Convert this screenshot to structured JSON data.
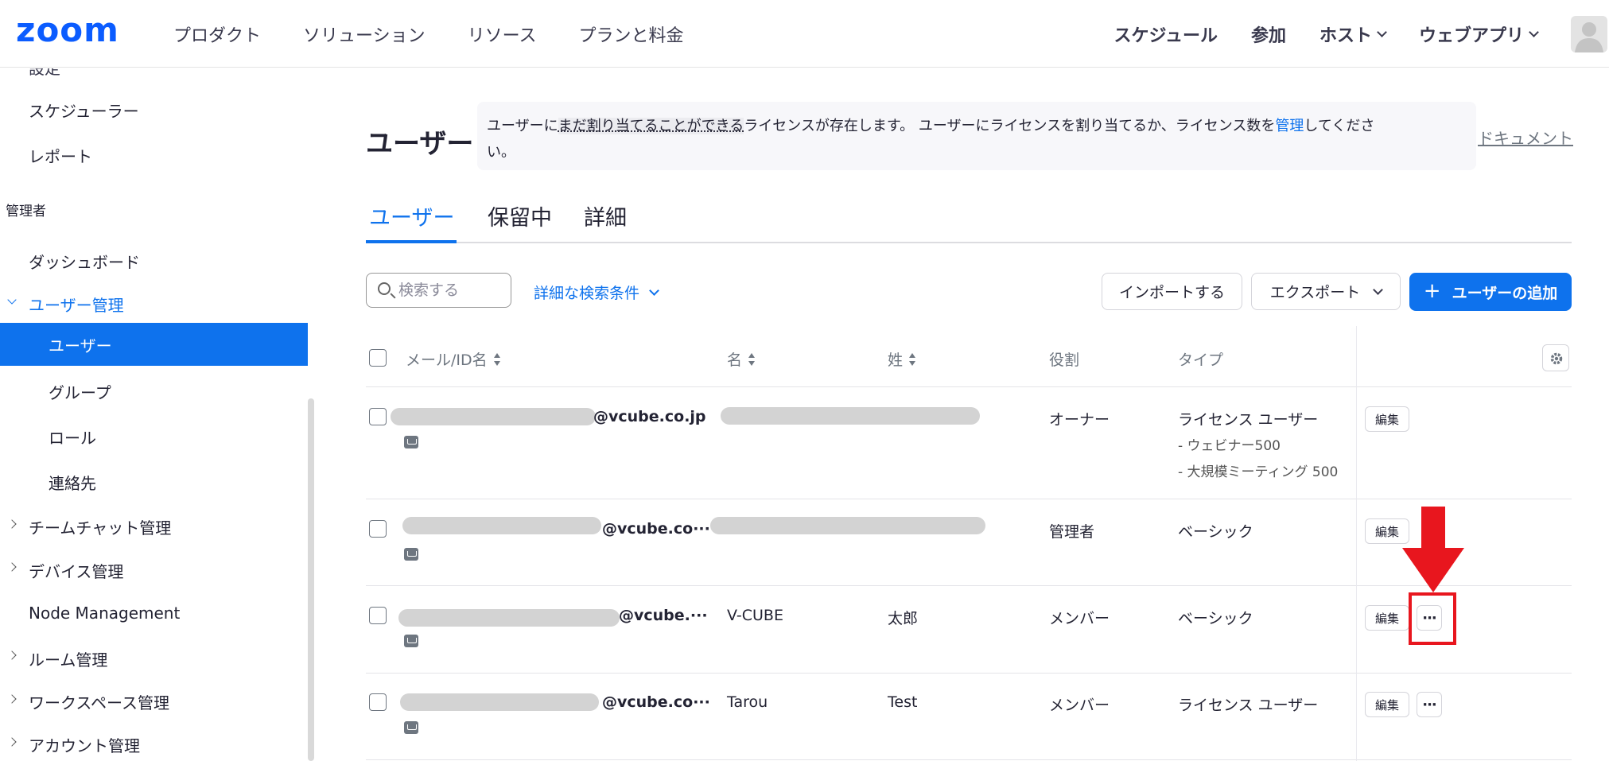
{
  "brand": {
    "logo_text": "zoom",
    "logo_color": "#0b5cff"
  },
  "topnav": {
    "left": [
      "プロダクト",
      "ソリューション",
      "リソース",
      "プランと料金"
    ],
    "right": {
      "schedule": "スケジュール",
      "join": "参加",
      "host": "ホスト",
      "web_app": "ウェブアプリ"
    }
  },
  "sidebar": {
    "partial_top": "設定",
    "scheduler": "スケジューラー",
    "reports": "レポート",
    "admin_section": "管理者",
    "dashboard": "ダッシュボード",
    "user_mgmt": "ユーザー管理",
    "users": "ユーザー",
    "groups": "グループ",
    "roles": "ロール",
    "contacts": "連絡先",
    "team_chat": "チームチャット管理",
    "devices": "デバイス管理",
    "node": "Node Management",
    "rooms": "ルーム管理",
    "workspaces": "ワークスペース管理",
    "account": "アカウント管理"
  },
  "main": {
    "title": "ユーザー",
    "banner": {
      "part1": "ユーザーに",
      "underlined": "まだ割り当てることができる",
      "part2": "ライセンスが存在します。 ユーザーにライセンスを割り当てるか、ライセンス数を",
      "link": "管理",
      "part3": "してくださ",
      "part4": "い。"
    },
    "doc_link": "ドキュメント",
    "tabs": [
      "ユーザー",
      "保留中",
      "詳細"
    ],
    "search_placeholder": "検索する",
    "advanced_search": "詳細な検索条件",
    "import": "インポートする",
    "export": "エクスポート",
    "add_user": "ユーザーの追加",
    "add_plus": "+"
  },
  "table": {
    "columns": {
      "email": "メール/ID名",
      "first": "名",
      "last": "姓",
      "role": "役割",
      "type": "タイプ"
    },
    "rows": [
      {
        "email_suffix": "@vcube.co.jp",
        "first": "",
        "last": "",
        "role": "オーナー",
        "type": "ライセンス ユーザー",
        "type_sub1": "- ウェビナー500",
        "type_sub2": "- 大規模ミーティング 500",
        "edit": "編集"
      },
      {
        "email_suffix": "@vcube.co···",
        "first": "",
        "last": "",
        "role": "管理者",
        "type": "ベーシック",
        "edit": "編集"
      },
      {
        "email_suffix": "@vcube.···",
        "first": "V-CUBE",
        "last": "太郎",
        "role": "メンバー",
        "type": "ベーシック",
        "edit": "編集",
        "more": "···"
      },
      {
        "email_suffix": "@vcube.co···",
        "first": "Tarou",
        "last": "Test",
        "role": "メンバー",
        "type": "ライセンス ユーザー",
        "edit": "編集",
        "more": "···"
      }
    ]
  },
  "annotation": {
    "color": "#e8161e"
  }
}
